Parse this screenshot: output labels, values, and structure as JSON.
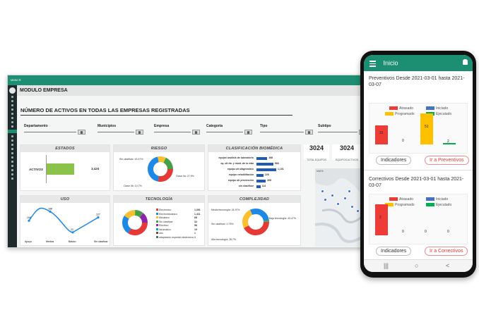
{
  "desktop": {
    "topbar_label": "MMM  ☰",
    "module_header": "MODULO EMPRESA",
    "page_title": "NÚMERO DE ACTIVOS EN TODAS LAS EMPRESAS REGISTRADAS",
    "filters": [
      "Departamento",
      "Municipios",
      "Empresa",
      "Categoría",
      "Tipo",
      "Subtipo"
    ],
    "estados": {
      "title": "ESTADOS",
      "label": "ACTIVOS",
      "value": "3,424",
      "fill": 0.68
    },
    "riesgo": {
      "title": "RIESGO",
      "labels": [
        "Sin clasificar: 43.47%",
        "Clase IIa: 27.9%",
        "Clase IIb: 10.7%"
      ],
      "slices": [
        {
          "name": "Clase IIa",
          "value": 27.9,
          "color": "#e53935"
        },
        {
          "name": "Sin clasificar",
          "value": 43.47,
          "color": "#1e88e5"
        },
        {
          "name": "Clase IIb",
          "value": 10.7,
          "color": "#fbc02d"
        },
        {
          "name": "otro",
          "value": 17.93,
          "color": "#43a047"
        }
      ]
    },
    "clasificacion": {
      "title": "CLASIFICACIÓN BIOMÉDICA",
      "rows": [
        {
          "label": "equipo análisis de laboratorio",
          "value": "366",
          "frac": 0.55
        },
        {
          "label": "eq. de tto. y mant. de la vida",
          "value": "566",
          "frac": 0.85
        },
        {
          "label": "equipo de diagnóstico",
          "value": "1,101",
          "frac": 1.0
        },
        {
          "label": "equipo rehabilitación",
          "value": "226",
          "frac": 0.35
        },
        {
          "label": "equipo de prevención",
          "value": "305",
          "frac": 0.47
        },
        {
          "label": "sin clasificar",
          "value": "114",
          "frac": 0.2
        }
      ]
    },
    "kpis": [
      {
        "value": "3024",
        "label": "TOTAL EQUIPOS"
      },
      {
        "value": "3024",
        "label": "EQUIPOS ACTIVOS"
      }
    ],
    "uso": {
      "title": "USO",
      "categories": [
        "Apoyo",
        "Medios",
        "Básico",
        "Sin clasificar"
      ],
      "values": [
        104,
        168,
        21,
        127
      ]
    },
    "tecnologia": {
      "title": "TECNOLOGÍA",
      "items": [
        {
          "label": "Electrónico",
          "value": "1,391"
        },
        {
          "label": "Electromecánico",
          "value": "1,411"
        },
        {
          "label": "Mecánico",
          "value": "68"
        },
        {
          "label": "Sin clasificar",
          "value": "32"
        },
        {
          "label": "Eléctrico",
          "value": "58"
        },
        {
          "label": "Neumático",
          "value": "19"
        },
        {
          "label": "otro",
          "value": "1"
        },
        {
          "label": "adaptación especial electrónica",
          "value": "1"
        }
      ]
    },
    "complejidad": {
      "title": "COMPLEJIDAD",
      "labels": [
        "Media tecnología: 24.97%",
        "Baja tecnología: 43.47%",
        "Sin clasificar: 0.75%",
        "Alta tecnología: 28.7%"
      ]
    },
    "map_label": "MAPA"
  },
  "phone": {
    "app_title": "Inicio",
    "preventivos": {
      "title": "Preventivos Desde 2021-03-01 hasta 2021-03-07",
      "legend": [
        "Atrasado",
        "Iniciado",
        "Programado",
        "Ejecutado"
      ],
      "bars": [
        {
          "name": "Atrasado",
          "value": 31
        },
        {
          "name": "Iniciado",
          "value": 0
        },
        {
          "name": "Programado",
          "value": 51
        },
        {
          "name": "Ejecutado",
          "value": 2
        }
      ],
      "btn_left": "Indicadores",
      "btn_right": "Ir a Preventivos"
    },
    "correctivos": {
      "title": "Correctivos Desde 2021-03-01 hasta 2021-03-07",
      "legend": [
        "Atrasado",
        "Iniciado",
        "Programado",
        "Ejecutado"
      ],
      "bars": [
        {
          "name": "Atrasado",
          "value": 2
        },
        {
          "name": "Iniciado",
          "value": 0
        },
        {
          "name": "Programado",
          "value": 0
        },
        {
          "name": "Ejecutado",
          "value": 0
        }
      ],
      "btn_left": "Indicadores",
      "btn_right": "Ir a Correctivos"
    },
    "nav": [
      "|||",
      "○",
      "<"
    ]
  },
  "colors": {
    "primary": "#1c8f72",
    "atrasado": "#ef3b36",
    "iniciado": "#4472c4",
    "programado": "#ffc000",
    "ejecutado": "#00b050"
  }
}
